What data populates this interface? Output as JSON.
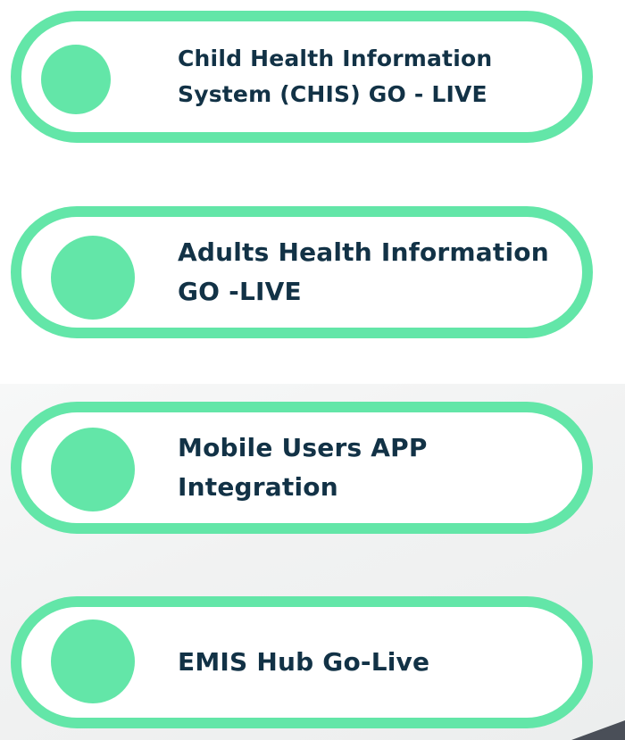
{
  "milestones": [
    {
      "label": "Child Health Information System (CHIS) GO - LIVE"
    },
    {
      "label": "Adults Health Information GO -LIVE"
    },
    {
      "label": "Mobile Users APP Integration"
    },
    {
      "label": "EMIS Hub Go-Live"
    }
  ],
  "colors": {
    "accent": "#63e6a8",
    "text": "#123246",
    "background": "#ffffff"
  }
}
